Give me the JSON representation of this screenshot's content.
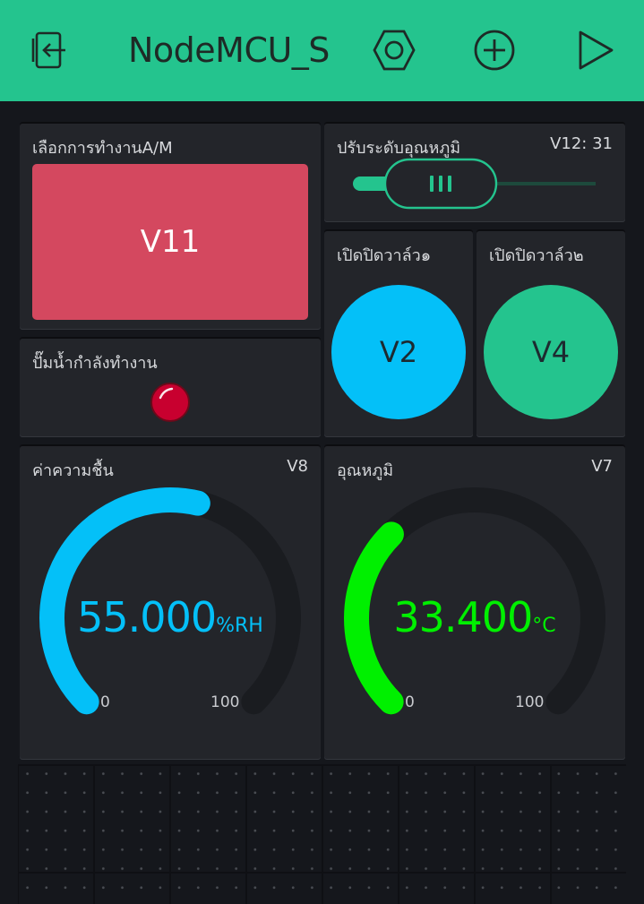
{
  "header": {
    "title": "NodeMCU_SM",
    "back_icon": "exit-icon",
    "settings_icon": "nut-settings-icon",
    "add_icon": "add-circle-icon",
    "play_icon": "play-icon"
  },
  "widgets": {
    "mode_button": {
      "label": "เลือกการทำงานA/M",
      "button_text": "V11",
      "color": "#d4485f"
    },
    "temp_slider": {
      "label": "ปรับระดับอุณหภูมิ",
      "pin": "V12: 31"
    },
    "valve1": {
      "label": "เปิดปิดวาล์ว๑",
      "button_text": "V2",
      "color": "#04c0f8"
    },
    "valve2": {
      "label": "เปิดปิดวาล์ว๒",
      "button_text": "V4",
      "color": "#24c48e"
    },
    "pump_led": {
      "label": "ปั๊มน้ำกำลังทำงาน",
      "color": "#c8002f"
    },
    "humidity_gauge": {
      "label": "ค่าความชื้น",
      "pin": "V8",
      "value_text": "55.000",
      "unit": "%RH",
      "min_label": "0",
      "max_label": "100",
      "value": 55,
      "min": 0,
      "max": 100,
      "color": "#04c0f8"
    },
    "temp_gauge": {
      "label": "อุณหภูมิ",
      "pin": "V7",
      "value_text": "33.400",
      "unit": "°C",
      "min_label": "0",
      "max_label": "100",
      "value": 33.4,
      "min": 0,
      "max": 100,
      "color": "#00f000"
    }
  }
}
